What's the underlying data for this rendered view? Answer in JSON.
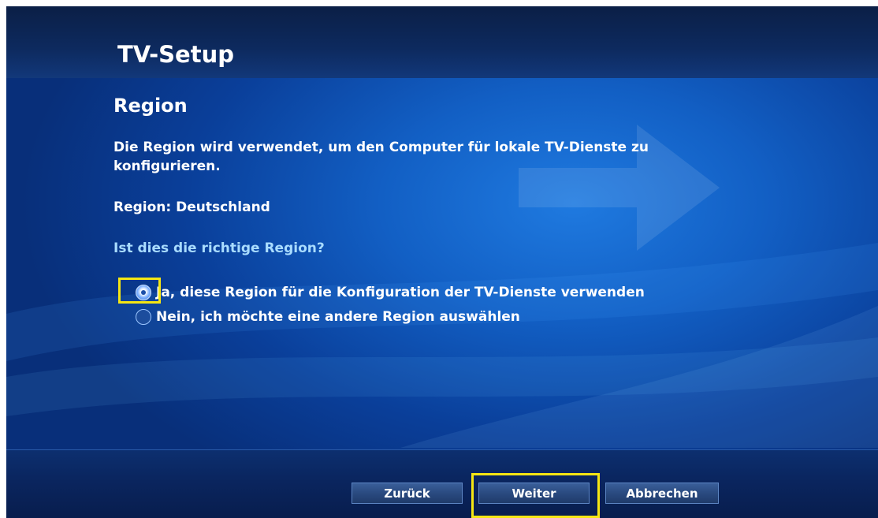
{
  "app": {
    "title": "TV-Setup"
  },
  "page": {
    "section_title": "Region",
    "description": "Die Region wird verwendet, um den Computer für lokale TV-Dienste zu konfigurieren.",
    "region_line": "Region: Deutschland",
    "question": "Ist dies die richtige Region?"
  },
  "options": [
    {
      "label": "Ja, diese Region für die Konfiguration der TV-Dienste verwenden",
      "selected": true
    },
    {
      "label": "Nein, ich möchte eine andere Region auswählen",
      "selected": false
    }
  ],
  "buttons": {
    "back": "Zurück",
    "next": "Weiter",
    "cancel": "Abbrechen"
  },
  "colors": {
    "highlight": "#f5e613",
    "question_text": "#a9dcff",
    "background_accent": "#1f7ae0"
  },
  "icons": {
    "background_decoration": "arrow-icon",
    "radio_selected": "radio-selected-icon",
    "radio_unselected": "radio-unselected-icon"
  }
}
